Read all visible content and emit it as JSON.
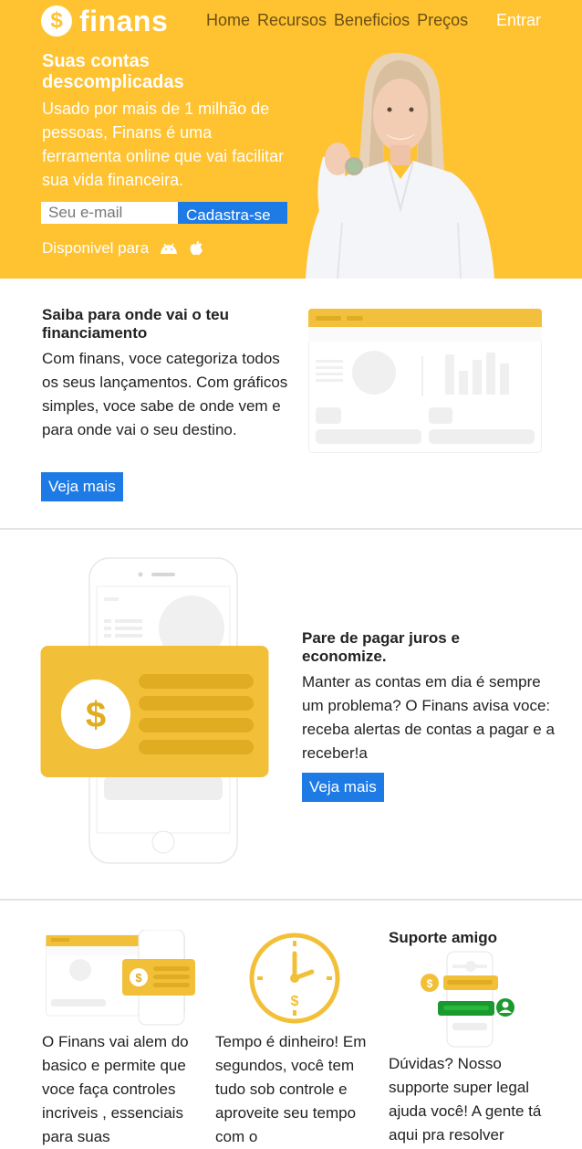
{
  "header": {
    "logo_symbol": "$",
    "logo_text": "finans",
    "nav": [
      "Home",
      "Recursos",
      "Beneficios",
      "Preços"
    ],
    "login_label": "Entrar"
  },
  "hero": {
    "title": "Suas contas descomplicadas",
    "text": "Usado por mais de 1 milhão de pessoas, Finans é uma ferramenta online que vai facilitar sua vida financeira.",
    "email_placeholder": "Seu e-mail",
    "signup_label": "Cadastra-se",
    "available_label": "Disponivel para",
    "platform_icons": [
      "android-icon",
      "apple-icon"
    ]
  },
  "section1": {
    "title": "Saiba para onde vai o teu financiamento",
    "text": "Com finans, voce categoriza todos os seus lançamentos. Com gráficos simples, voce sabe de onde vem e para onde vai o seu destino.",
    "button_label": "Veja mais"
  },
  "section2": {
    "title": "Pare de pagar juros e economize.",
    "text": "Manter as contas em dia é sempre um problema? O Finans avisa voce: receba alertas de contas a pagar e a receber!a",
    "button_label": "Veja mais",
    "card_symbol": "$"
  },
  "section3": {
    "support_title": "Suporte amigo",
    "col1_text": "O Finans vai alem do basico e permite que voce faça controles incriveis , essenciais para suas",
    "col2_text": "Tempo é dinheiro! Em segundos, você tem tudo sob controle e aproveite seu tempo com o",
    "col3_text": "Dúvidas? Nosso supporte super legal ajuda você! A gente tá aqui pra resolver",
    "coin_symbol": "$"
  },
  "colors": {
    "brand_yellow": "#ffc231",
    "card_yellow": "#f2c038",
    "button_blue": "#1e7be6",
    "support_green": "#1a9a2e"
  }
}
